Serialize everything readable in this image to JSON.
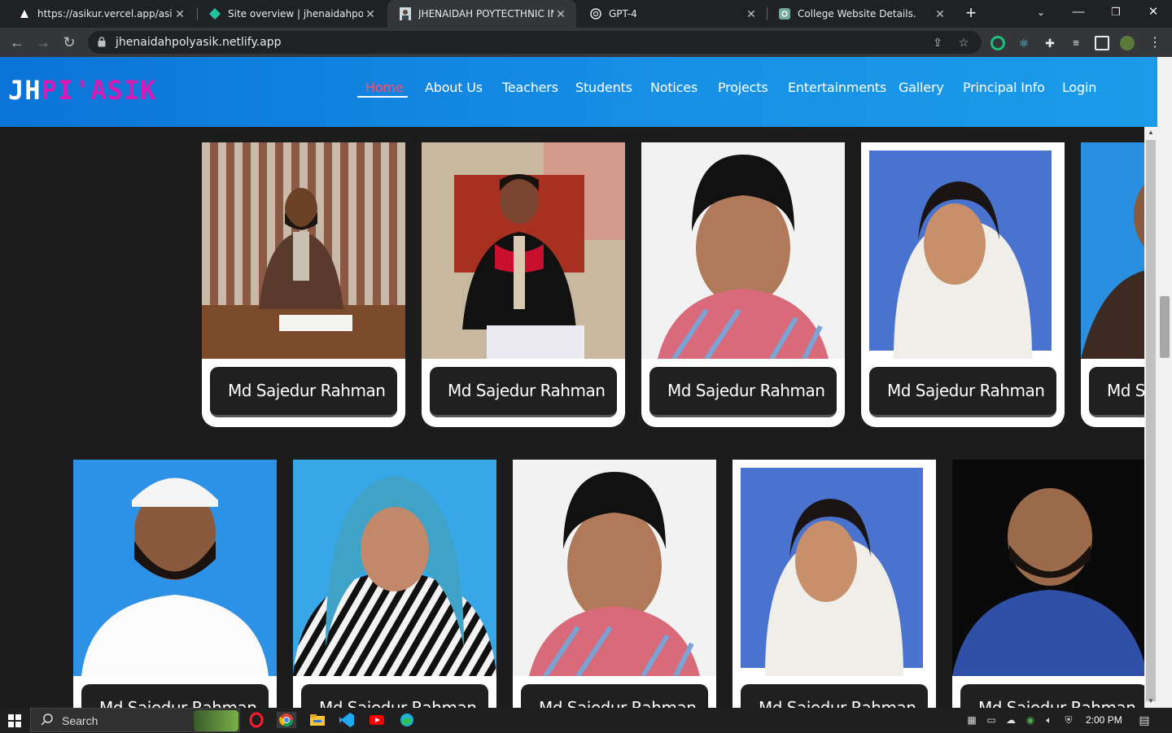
{
  "browser": {
    "tabs": [
      {
        "title": "https://asikur.vercel.app/asikur/",
        "active": false
      },
      {
        "title": "Site overview | jhenaidahpolyasik",
        "active": false
      },
      {
        "title": "JHENAIDAH POYTECTHNIC INSTITUTE",
        "active": true
      },
      {
        "title": "GPT-4",
        "active": false
      },
      {
        "title": "College Website Details.",
        "active": false
      }
    ],
    "url": "jhenaidahpolyasik.netlify.app"
  },
  "site": {
    "logo_part1": "JH",
    "logo_part2": "PI'ASIK",
    "nav": [
      "Home",
      "About Us",
      "Teachers",
      "Students",
      "Notices",
      "Projects",
      "Entertainments",
      "Gallery",
      "Principal Info",
      "Login"
    ],
    "active_nav": "Home"
  },
  "cards": {
    "row1": [
      {
        "name": "Md Sajedur Rahman"
      },
      {
        "name": "Md Sajedur Rahman"
      },
      {
        "name": "Md Sajedur Rahman"
      },
      {
        "name": "Md Sajedur Rahman"
      },
      {
        "name": "Md Sajedur Rahman"
      }
    ],
    "row2": [
      {
        "name": "Md Sajedur Rahman"
      },
      {
        "name": "Md Sajedur Rahman"
      },
      {
        "name": "Md Sajedur Rahman"
      },
      {
        "name": "Md Sajedur Rahman"
      },
      {
        "name": "Md Sajedur Rahman"
      }
    ]
  },
  "taskbar": {
    "search_placeholder": "Search",
    "time": "2:00 PM"
  }
}
